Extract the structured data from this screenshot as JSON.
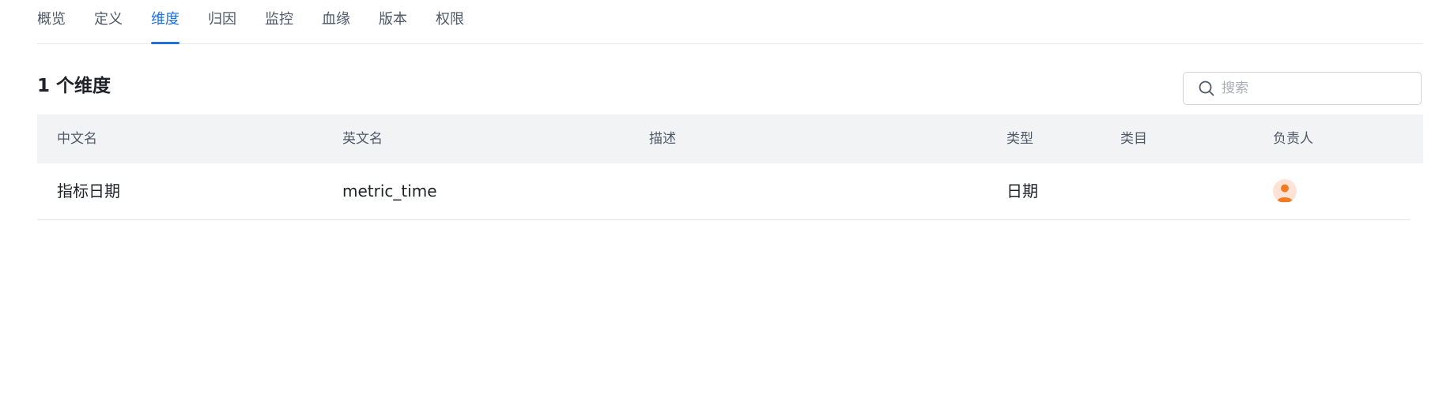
{
  "tabs": [
    {
      "label": "概览",
      "active": false
    },
    {
      "label": "定义",
      "active": false
    },
    {
      "label": "维度",
      "active": true
    },
    {
      "label": "归因",
      "active": false
    },
    {
      "label": "监控",
      "active": false
    },
    {
      "label": "血缘",
      "active": false
    },
    {
      "label": "版本",
      "active": false
    },
    {
      "label": "权限",
      "active": false
    }
  ],
  "section": {
    "title": "1 个维度"
  },
  "search": {
    "placeholder": "搜索",
    "value": "",
    "icon": "search-icon"
  },
  "table": {
    "columns": [
      "中文名",
      "英文名",
      "描述",
      "类型",
      "类目",
      "负责人"
    ],
    "rows": [
      {
        "chinese_name": "指标日期",
        "english_name": "metric_time",
        "description": "",
        "type": "日期",
        "category": "",
        "owner_icon": "user-avatar-icon"
      }
    ]
  },
  "colors": {
    "accent": "#1f6fe0",
    "header_bg": "#f2f3f5",
    "avatar_bg": "#fde3d6",
    "avatar_fg": "#f47b20"
  }
}
